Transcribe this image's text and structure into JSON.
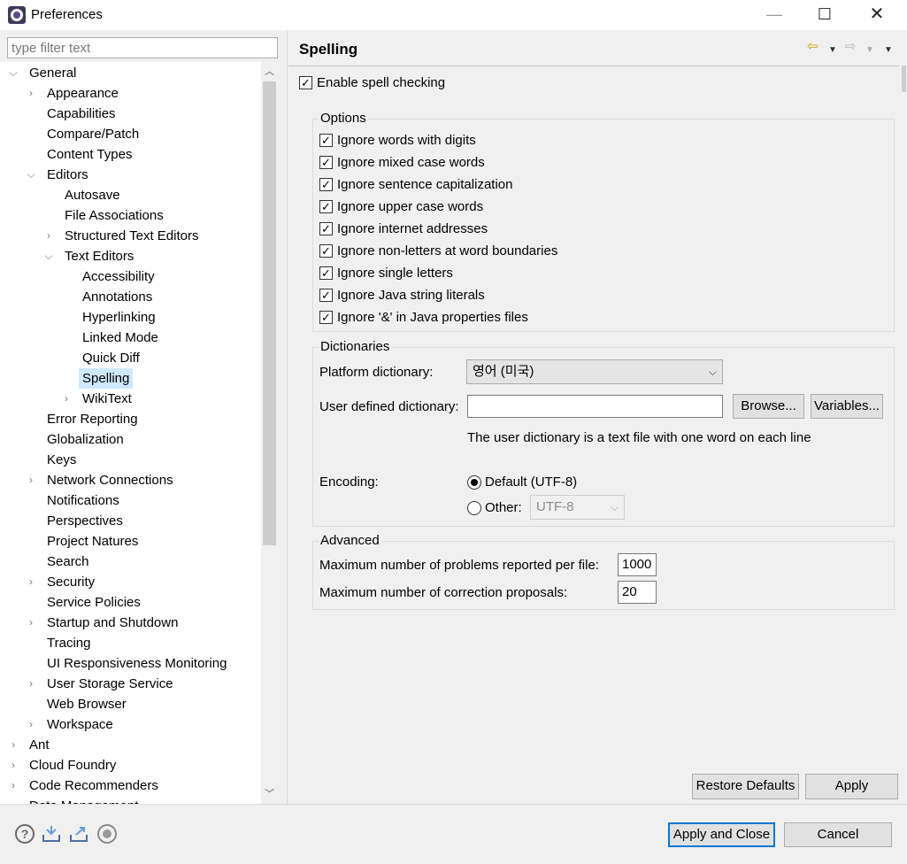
{
  "window": {
    "title": "Preferences",
    "minimize_glyph": "—",
    "maximize_glyph": "☐",
    "close_glyph": "✕"
  },
  "filter": {
    "placeholder": "type filter text",
    "value": ""
  },
  "tree": [
    {
      "label": "General",
      "level": 0,
      "expander": "open"
    },
    {
      "label": "Appearance",
      "level": 1,
      "expander": "closed"
    },
    {
      "label": "Capabilities",
      "level": 1,
      "expander": "none"
    },
    {
      "label": "Compare/Patch",
      "level": 1,
      "expander": "none"
    },
    {
      "label": "Content Types",
      "level": 1,
      "expander": "none"
    },
    {
      "label": "Editors",
      "level": 1,
      "expander": "open"
    },
    {
      "label": "Autosave",
      "level": 2,
      "expander": "none"
    },
    {
      "label": "File Associations",
      "level": 2,
      "expander": "none"
    },
    {
      "label": "Structured Text Editors",
      "level": 2,
      "expander": "closed"
    },
    {
      "label": "Text Editors",
      "level": 2,
      "expander": "open"
    },
    {
      "label": "Accessibility",
      "level": 3,
      "expander": "none"
    },
    {
      "label": "Annotations",
      "level": 3,
      "expander": "none"
    },
    {
      "label": "Hyperlinking",
      "level": 3,
      "expander": "none"
    },
    {
      "label": "Linked Mode",
      "level": 3,
      "expander": "none"
    },
    {
      "label": "Quick Diff",
      "level": 3,
      "expander": "none"
    },
    {
      "label": "Spelling",
      "level": 3,
      "expander": "none",
      "selected": true
    },
    {
      "label": "WikiText",
      "level": 3,
      "expander": "closed"
    },
    {
      "label": "Error Reporting",
      "level": 1,
      "expander": "none"
    },
    {
      "label": "Globalization",
      "level": 1,
      "expander": "none"
    },
    {
      "label": "Keys",
      "level": 1,
      "expander": "none"
    },
    {
      "label": "Network Connections",
      "level": 1,
      "expander": "closed"
    },
    {
      "label": "Notifications",
      "level": 1,
      "expander": "none"
    },
    {
      "label": "Perspectives",
      "level": 1,
      "expander": "none"
    },
    {
      "label": "Project Natures",
      "level": 1,
      "expander": "none"
    },
    {
      "label": "Search",
      "level": 1,
      "expander": "none"
    },
    {
      "label": "Security",
      "level": 1,
      "expander": "closed"
    },
    {
      "label": "Service Policies",
      "level": 1,
      "expander": "none"
    },
    {
      "label": "Startup and Shutdown",
      "level": 1,
      "expander": "closed"
    },
    {
      "label": "Tracing",
      "level": 1,
      "expander": "none"
    },
    {
      "label": "UI Responsiveness Monitoring",
      "level": 1,
      "expander": "none"
    },
    {
      "label": "User Storage Service",
      "level": 1,
      "expander": "closed"
    },
    {
      "label": "Web Browser",
      "level": 1,
      "expander": "none"
    },
    {
      "label": "Workspace",
      "level": 1,
      "expander": "closed"
    },
    {
      "label": "Ant",
      "level": 0,
      "expander": "closed"
    },
    {
      "label": "Cloud Foundry",
      "level": 0,
      "expander": "closed"
    },
    {
      "label": "Code Recommenders",
      "level": 0,
      "expander": "closed"
    },
    {
      "label": "Data Management",
      "level": 0,
      "expander": "closed"
    }
  ],
  "page": {
    "title": "Spelling",
    "enable_spell": {
      "label": "Enable spell checking",
      "checked": true
    },
    "options": {
      "title": "Options",
      "items": [
        {
          "label": "Ignore words with digits",
          "checked": true
        },
        {
          "label": "Ignore mixed case words",
          "checked": true
        },
        {
          "label": "Ignore sentence capitalization",
          "checked": true
        },
        {
          "label": "Ignore upper case words",
          "checked": true
        },
        {
          "label": "Ignore internet addresses",
          "checked": true
        },
        {
          "label": "Ignore non-letters at word boundaries",
          "checked": true
        },
        {
          "label": "Ignore single letters",
          "checked": true
        },
        {
          "label": "Ignore Java string literals",
          "checked": true
        },
        {
          "label": "Ignore '&' in Java properties files",
          "checked": true
        }
      ]
    },
    "dictionaries": {
      "title": "Dictionaries",
      "platform_label": "Platform dictionary:",
      "platform_value": "영어 (미국)",
      "user_label": "User defined dictionary:",
      "user_value": "",
      "browse_label": "Browse...",
      "variables_label": "Variables...",
      "hint": "The user dictionary is a text file with one word on each line",
      "encoding_label": "Encoding:",
      "default_label": "Default (UTF-8)",
      "default_selected": true,
      "other_label": "Other:",
      "other_selected": false,
      "other_value": "UTF-8"
    },
    "advanced": {
      "title": "Advanced",
      "max_problems_label": "Maximum number of problems reported per file:",
      "max_problems_value": "1000",
      "max_corrections_label": "Maximum number of correction proposals:",
      "max_corrections_value": "20"
    },
    "restore_defaults_label": "Restore Defaults",
    "apply_label": "Apply"
  },
  "footer": {
    "apply_close_label": "Apply and Close",
    "cancel_label": "Cancel",
    "icons": [
      "help-icon",
      "import-icon",
      "export-icon",
      "record-icon"
    ]
  },
  "glyphs": {
    "check": "✓",
    "expander_open": "⌵",
    "expander_closed": "›",
    "chevron_down": "⌵",
    "scroll_up": "︿",
    "scroll_down": "﹀",
    "nav_back": "⇦",
    "nav_forward": "⇨",
    "dropdown": "▼",
    "help": "?"
  },
  "colors": {
    "selection": "#cde8ff",
    "default_button_border": "#0078d7"
  }
}
